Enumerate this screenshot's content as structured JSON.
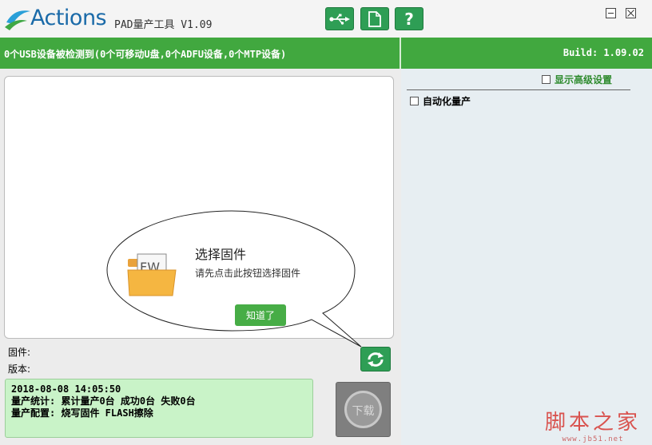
{
  "titlebar": {
    "logo_text": "Actions",
    "app_title": "PAD量产工具 V1.09",
    "buttons": [
      {
        "name": "usb-icon"
      },
      {
        "name": "document-icon"
      },
      {
        "name": "help-icon",
        "glyph": "?"
      }
    ]
  },
  "statusbar": {
    "device_status": "0个USB设备被检测到(0个可移动U盘,0个ADFU设备,0个MTP设备)",
    "build": "Build: 1.09.02"
  },
  "firmware_prompt": {
    "icon_label": "FW",
    "title": "选择固件",
    "subtitle": "请先点击此按钮选择固件",
    "ok_button": "知道了"
  },
  "firmware_info": {
    "firmware_label": "固件:",
    "version_label": "版本:"
  },
  "log": {
    "lines": [
      "2018-08-08 14:05:50",
      "量产统计: 累计量产0台 成功0台 失败0台",
      "量产配置: 烧写固件 FLASH擦除"
    ]
  },
  "download_button": {
    "label": "下载"
  },
  "settings": {
    "show_advanced": "显示高级设置",
    "auto_production": "自动化量产"
  },
  "watermark": {
    "main": "脚本之家",
    "sub": "www.jb51.net"
  },
  "colors": {
    "accent_green": "#41a83f",
    "log_bg": "#c9f3c8",
    "brand_blue": "#1a6aa8"
  }
}
